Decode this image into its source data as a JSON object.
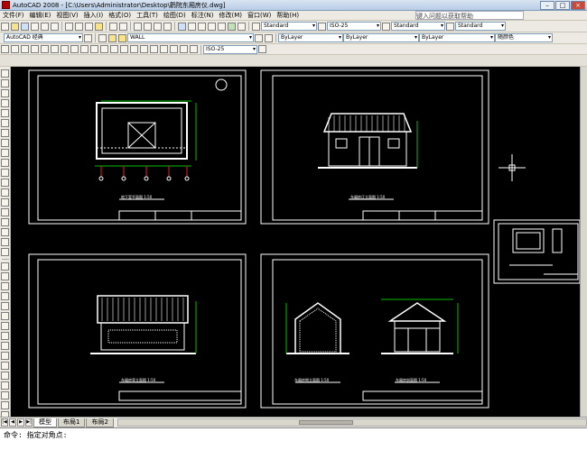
{
  "window": {
    "title": "AutoCAD 2008 - [C:\\Users\\Administrator\\Desktop\\鹳院东厢房仪.dwg]",
    "buttons": {
      "minimize": "–",
      "maximize": "□",
      "close": "×"
    }
  },
  "menu": {
    "items": [
      "文件(F)",
      "编辑(E)",
      "视图(V)",
      "插入(I)",
      "格式(O)",
      "工具(T)",
      "绘图(D)",
      "标注(N)",
      "修改(M)",
      "窗口(W)",
      "帮助(H)"
    ],
    "help_search_placeholder": "键入问题以获取帮助"
  },
  "toolbar2": {
    "text_style": "Standard",
    "dim_style": "ISO-25",
    "table_style": "Standard",
    "ml_style": "Standard"
  },
  "toolbar3": {
    "workspace": "AutoCAD 经典",
    "layer": "WALL",
    "color": "ByLayer",
    "linetype": "ByLayer",
    "lineweight": "ByLayer",
    "plotstyle": "随颜色",
    "dim_scale": "ISO-25"
  },
  "sheets": {
    "plan_title": "地下室平面图 1:50",
    "front_title": "东厢房正立面图 1:50",
    "back_title": "东厢房背立面图 1:50",
    "section_title": "东厢房剖面图 1:50",
    "side_title": "东厢房侧立面图 1:50"
  },
  "layout_tabs": [
    "模型",
    "布局1",
    "布局2"
  ],
  "active_tab": "模型",
  "command": {
    "prompt": "命令: 指定对角点:"
  },
  "colors": {
    "canvas": "#000000",
    "lines": "#ffffff",
    "dim_green": "#00c000",
    "axis_red": "#e02020"
  }
}
